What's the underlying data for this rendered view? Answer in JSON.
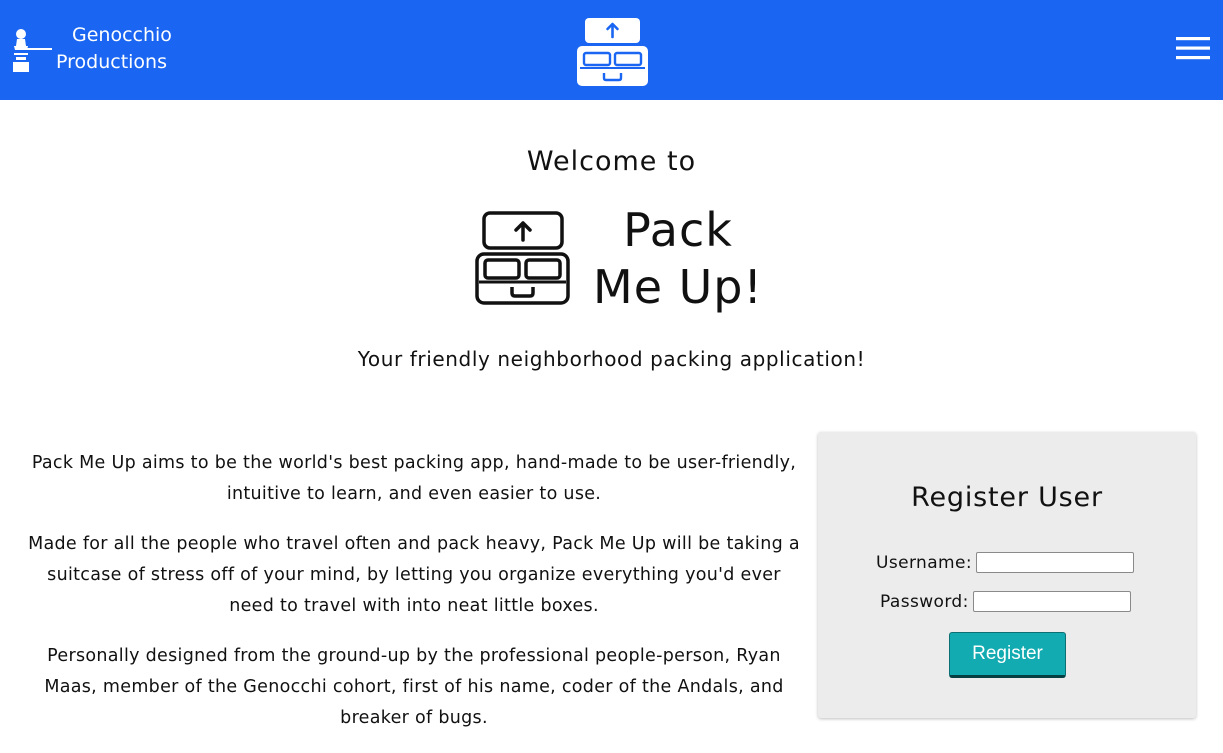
{
  "header": {
    "brand_line1": "Genocchio",
    "brand_line2": "Productions",
    "brand_icon": "chess-pawn-icon",
    "logo_icon": "open-suitcase-icon",
    "menu_icon": "hamburger-menu-icon",
    "bg_color": "#1a66f2"
  },
  "hero": {
    "welcome": "Welcome to",
    "title_line1": "Pack",
    "title_line2": "Me Up!",
    "tagline": "Your friendly neighborhood packing application!"
  },
  "about": {
    "paragraphs": [
      "Pack Me Up aims to be the world's best packing app, hand-made to be user-friendly, intuitive to learn, and even easier to use.",
      "Made for all the people who travel often and pack heavy, Pack Me Up will be taking a suitcase of stress off of your mind, by letting you organize everything you'd ever need to travel with into neat little boxes.",
      "Personally designed from the ground-up by the professional people-person, Ryan Maas, member of the Genocchi cohort, first of his name, coder of the Andals, and breaker of bugs."
    ]
  },
  "register": {
    "title": "Register User",
    "username_label": "Username:",
    "username_value": "",
    "password_label": "Password:",
    "password_value": "",
    "button_label": "Register",
    "button_color": "#12abb1"
  }
}
